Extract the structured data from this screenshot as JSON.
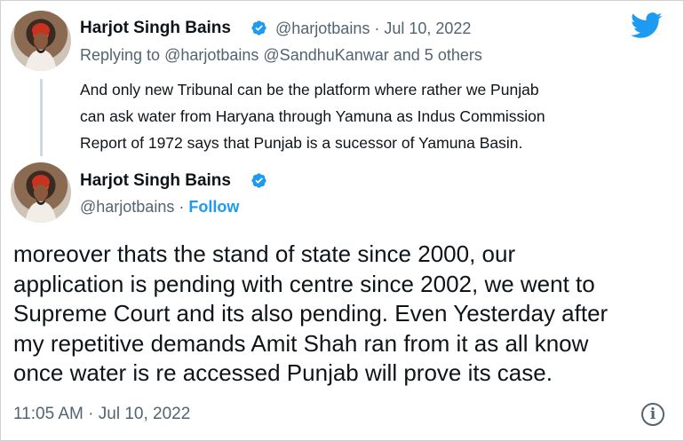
{
  "parent_tweet": {
    "author_name": "Harjot Singh Bains",
    "handle_time": "@harjotbains · Jul 10, 2022",
    "reply_prefix": "Replying to",
    "reply_to": "@harjotbains @SandhuKanwar and 5 others",
    "text_lines": [
      "And only new Tribunal can be the platform where rather we Punjab",
      "can ask water from Haryana through Yamuna as Indus Commission",
      "Report of 1972 says that Punjab is a sucessor of Yamuna Basin."
    ]
  },
  "main_tweet": {
    "author_name": "Harjot Singh Bains",
    "handle": "@harjotbains",
    "separator": " · ",
    "follow_label": "Follow",
    "text_lines": [
      "moreover thats the stand of state since 2000, our",
      "application is pending with centre since 2002, we went to",
      "Supreme Court and its also pending. Even Yesterday after",
      "my repetitive demands Amit Shah ran from it as all know",
      "once water is re accessed Punjab will prove its case."
    ],
    "timestamp": "11:05 AM · Jul 10, 2022"
  },
  "icons": {
    "brand": "twitter-bird-icon",
    "verified": "verified-badge-icon",
    "info": "info-icon",
    "info_glyph": "i"
  },
  "colors": {
    "twitter_blue": "#1d9bf0",
    "text_primary": "#0f1419",
    "text_secondary": "#536471"
  }
}
